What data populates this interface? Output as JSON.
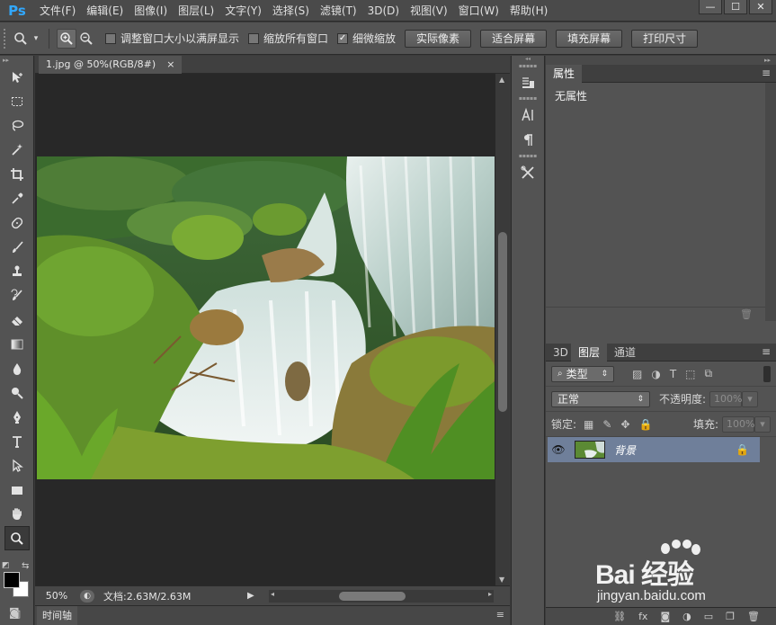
{
  "app": {
    "logo": "Ps"
  },
  "menu": [
    "文件(F)",
    "编辑(E)",
    "图像(I)",
    "图层(L)",
    "文字(Y)",
    "选择(S)",
    "滤镜(T)",
    "3D(D)",
    "视图(V)",
    "窗口(W)",
    "帮助(H)"
  ],
  "window_controls": {
    "minimize": "—",
    "maximize": "☐",
    "close": "✕"
  },
  "options": {
    "tool_icon": "zoom-icon",
    "checks": [
      {
        "label": "调整窗口大小以满屏显示",
        "checked": false
      },
      {
        "label": "缩放所有窗口",
        "checked": false
      },
      {
        "label": "细微缩放",
        "checked": true
      }
    ],
    "check_mark": "✓",
    "buttons": [
      "实际像素",
      "适合屏幕",
      "填充屏幕",
      "打印尺寸"
    ]
  },
  "document": {
    "tab_title": "1.jpg @ 50%(RGB/8#)",
    "close_glyph": "×",
    "zoom": "50%",
    "doc_size": "文档:2.63M/2.63M",
    "arrow": "▶"
  },
  "timeline": {
    "label": "时间轴"
  },
  "properties": {
    "tab": "属性",
    "content": "无属性"
  },
  "layers": {
    "tabs": [
      "3D",
      "图层",
      "通道"
    ],
    "filter_label": "类型",
    "blend_mode": "正常",
    "opacity_label": "不透明度:",
    "opacity_value": "100%",
    "lock_label": "锁定:",
    "fill_label": "填充:",
    "fill_value": "100%",
    "items": [
      {
        "name": "背景",
        "visible": true,
        "locked": true
      }
    ],
    "footer_icons": [
      "link-icon",
      "fx-icon",
      "mask-icon",
      "adjustment-icon",
      "folder-icon",
      "new-layer-icon",
      "trash-icon"
    ],
    "fx_label": "fx"
  },
  "watermark": {
    "brand": "Bai 经验",
    "url": "jingyan.baidu.com"
  }
}
